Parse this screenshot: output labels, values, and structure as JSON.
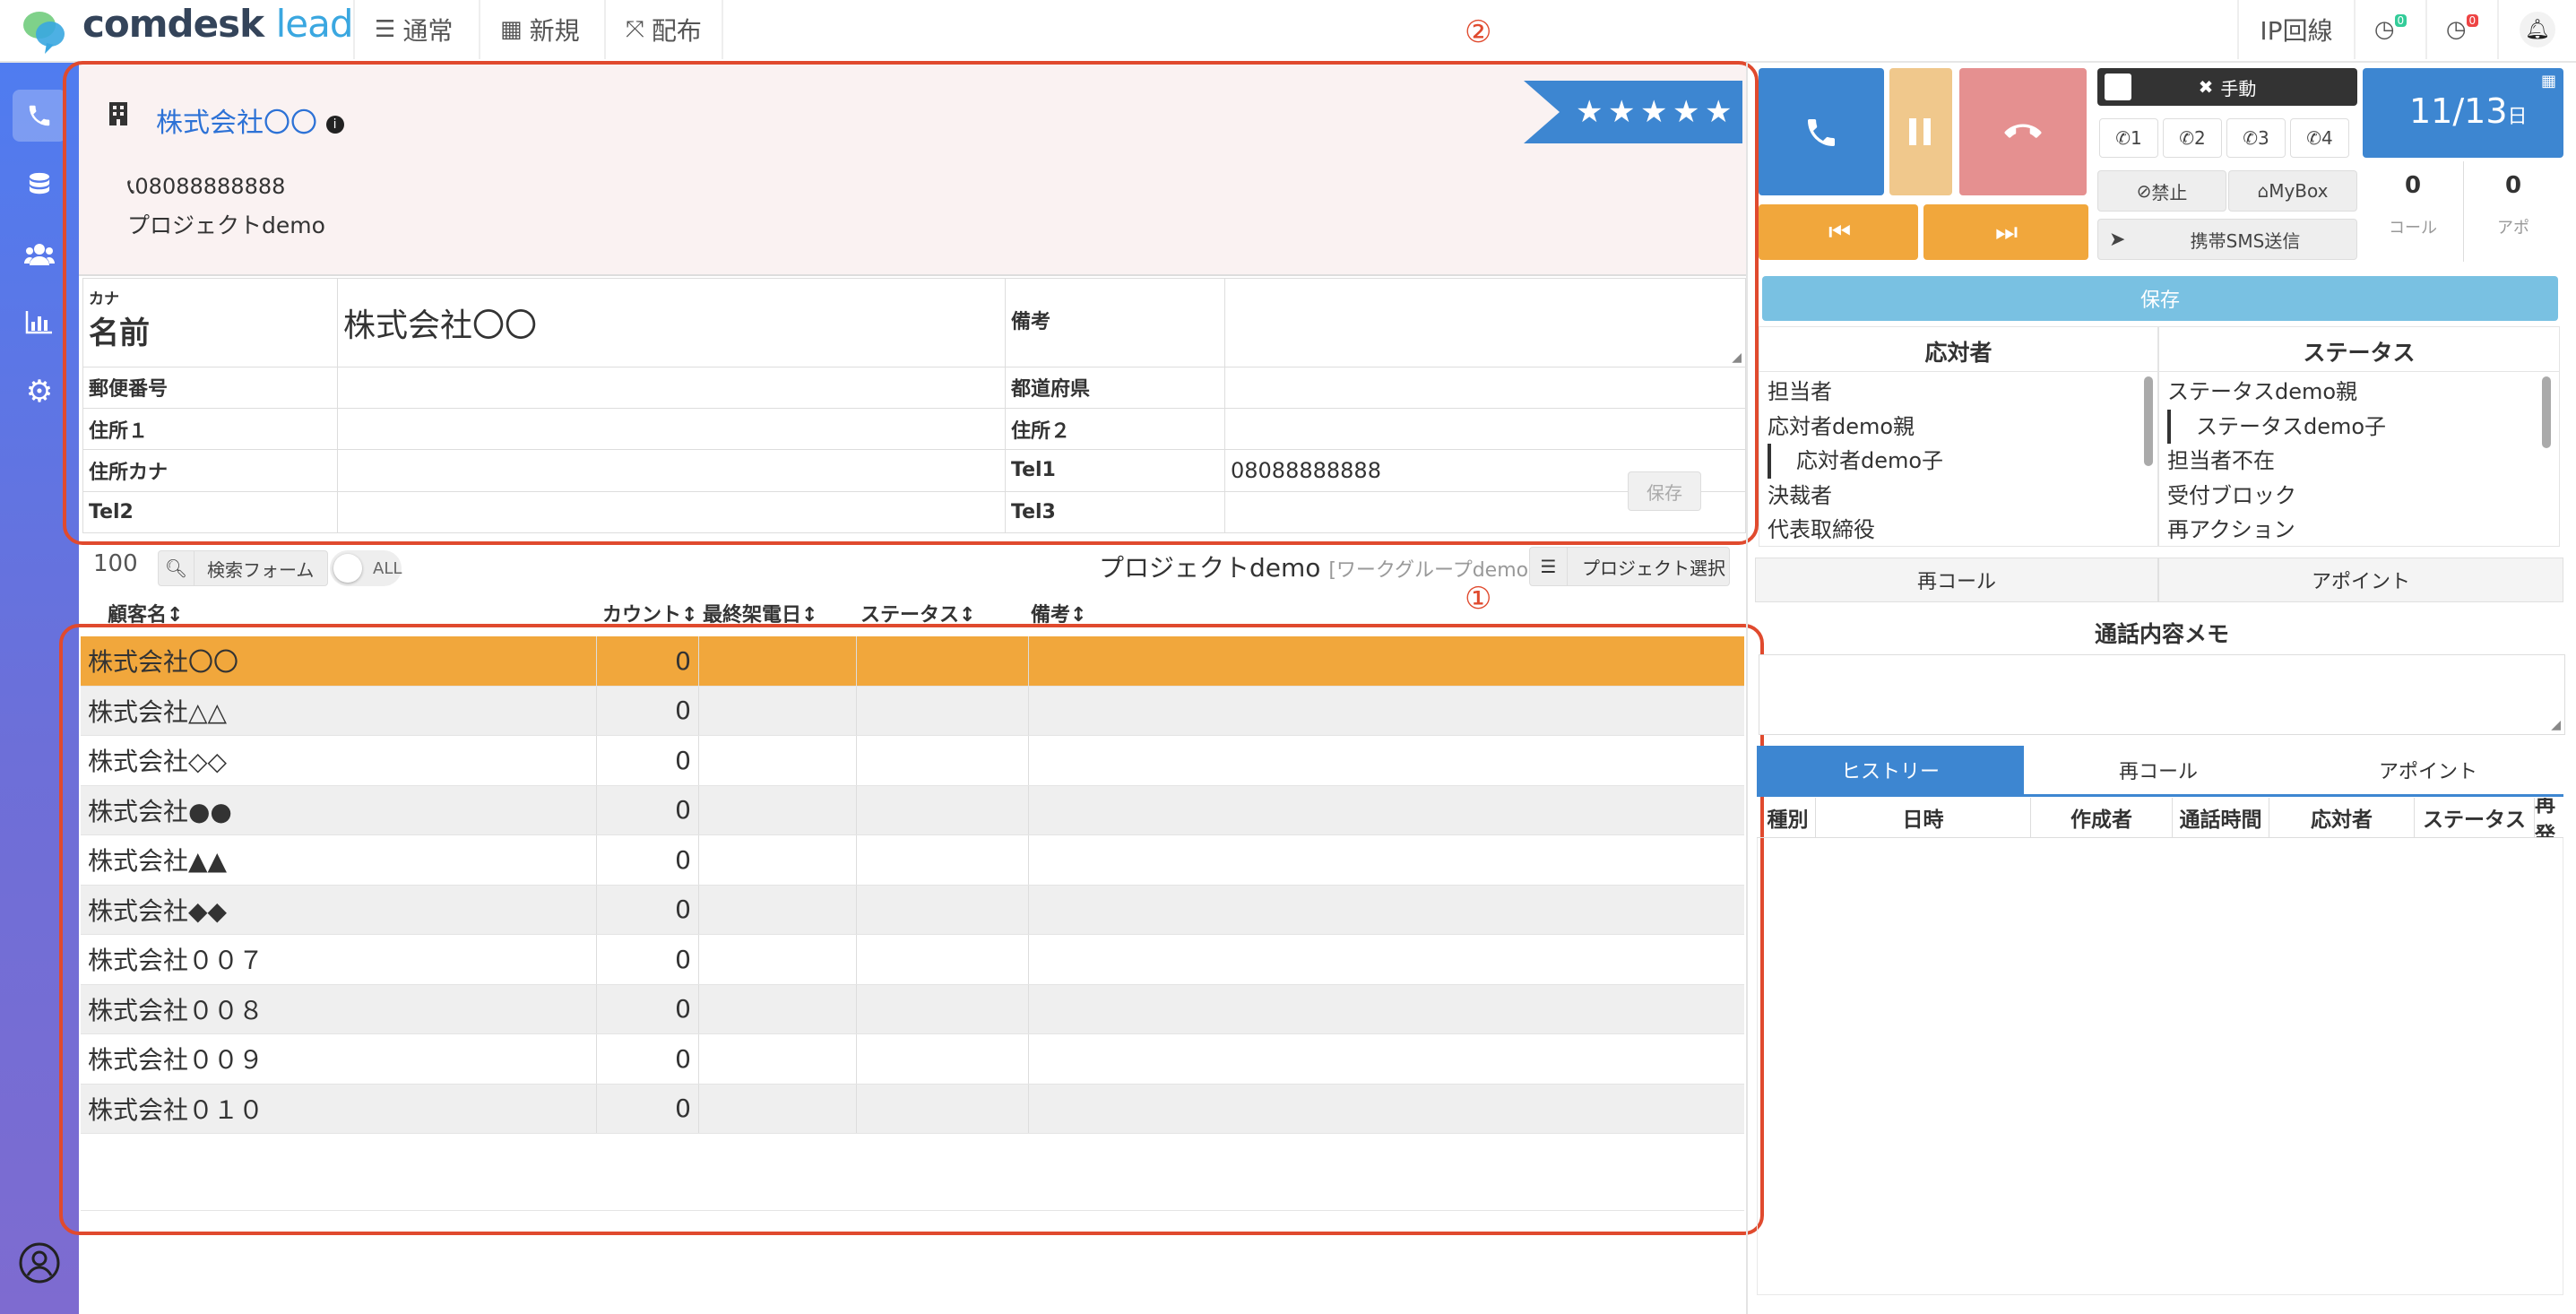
{
  "brand": {
    "name_main": "comdesk",
    "name_accent": "lead"
  },
  "nav": [
    {
      "label": "通常",
      "icon": "list-icon"
    },
    {
      "label": "新規",
      "icon": "grid-icon"
    },
    {
      "label": "配布",
      "icon": "expand-icon"
    }
  ],
  "topright": {
    "ip_label": "IP回線",
    "badge1": "0",
    "badge2": "0"
  },
  "annotations": {
    "one": "①",
    "two": "②"
  },
  "company": {
    "name": "株式会社〇〇",
    "phone": "08088888888",
    "project": "プロジェクトdemo",
    "rating_stars": 5
  },
  "form": {
    "kana_label": "カナ",
    "name_label": "名前",
    "name_value": "株式会社〇〇",
    "note_label": "備考",
    "zip_label": "郵便番号",
    "pref_label": "都道府県",
    "addr1_label": "住所１",
    "addr2_label": "住所２",
    "addr_kana_label": "住所カナ",
    "tel1_label": "Tel1",
    "tel1_value": "08088888888",
    "tel2_label": "Tel2",
    "tel3_label": "Tel3",
    "save_label": "保存"
  },
  "toolbar": {
    "count": "100",
    "search_label": "検索フォーム",
    "toggle_label": "ALL",
    "project": "プロジェクトdemo",
    "workgroup": "[ワークグループdemo]",
    "project_select": "プロジェクト選択"
  },
  "list": {
    "headers": [
      "顧客名",
      "カウント",
      "最終架電日",
      "ステータス",
      "備考"
    ],
    "rows": [
      {
        "name": "株式会社〇〇",
        "count": "0"
      },
      {
        "name": "株式会社△△",
        "count": "0"
      },
      {
        "name": "株式会社◇◇",
        "count": "0"
      },
      {
        "name": "株式会社●●",
        "count": "0"
      },
      {
        "name": "株式会社▲▲",
        "count": "0"
      },
      {
        "name": "株式会社◆◆",
        "count": "0"
      },
      {
        "name": "株式会社００７",
        "count": "0"
      },
      {
        "name": "株式会社００８",
        "count": "0"
      },
      {
        "name": "株式会社００９",
        "count": "0"
      },
      {
        "name": "株式会社０１０",
        "count": "0"
      }
    ]
  },
  "phone": {
    "manual_label": "手動",
    "exts": [
      "1",
      "2",
      "3",
      "4"
    ],
    "block_label": "禁止",
    "mybox_label": "MyBox",
    "sms_label": "携帯SMS送信",
    "date": "11/13",
    "date_suffix": "日",
    "calls": "0",
    "calls_label": "コール",
    "appts": "0",
    "appts_label": "アポ",
    "save_label": "保存"
  },
  "responder": {
    "title": "応対者",
    "items": [
      "担当者",
      "応対者demo親",
      "応対者demo子",
      "決裁者",
      "代表取締役"
    ]
  },
  "status": {
    "title": "ステータス",
    "items": [
      "ステータスdemo親",
      "ステータスdemo子",
      "担当者不在",
      "受付ブロック",
      "再アクション"
    ]
  },
  "actions": {
    "recall": "再コール",
    "appoint": "アポイント",
    "memo_title": "通話内容メモ"
  },
  "history": {
    "tabs": [
      "ヒストリー",
      "再コール",
      "アポイント"
    ],
    "headers": [
      "種別",
      "日時",
      "作成者",
      "通話時間",
      "応対者",
      "ステータス",
      "再発"
    ]
  },
  "colors": {
    "accent": "#3d86d1",
    "orange": "#f1a73c",
    "red": "#e04a2e"
  }
}
